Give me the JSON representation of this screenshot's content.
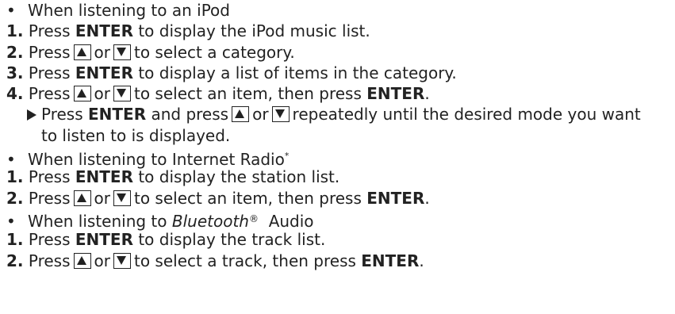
{
  "bullet_char": "•",
  "ipod": {
    "heading": "When listening to an iPod",
    "steps": [
      {
        "num": "1.",
        "pre": "Press",
        "key": "ENTER",
        "post": "to display the iPod music list."
      },
      {
        "num": "2.",
        "pre": "Press",
        "or": "or",
        "post": "to select a category."
      },
      {
        "num": "3.",
        "pre": "Press",
        "key": "ENTER",
        "post": "to display a list of items in the category."
      },
      {
        "num": "4.",
        "pre": "Press",
        "or": "or",
        "post": "to select an item, then press",
        "key": "ENTER",
        "end": "."
      }
    ],
    "note": {
      "pre": "Press",
      "key": "ENTER",
      "mid": "and press",
      "or": "or",
      "post": "repeatedly until the desired mode you want",
      "cont": "to listen to is displayed."
    }
  },
  "radio": {
    "heading": "When listening to Internet Radio",
    "asterisk": "*",
    "steps": [
      {
        "num": "1.",
        "pre": "Press",
        "key": "ENTER",
        "post": "to display the station list."
      },
      {
        "num": "2.",
        "pre": "Press",
        "or": "or",
        "post": "to select an item, then press",
        "key": "ENTER",
        "end": "."
      }
    ]
  },
  "bluetooth": {
    "heading_pre": "When listening to",
    "heading_brand": "Bluetooth",
    "reg": "®",
    "heading_post": "Audio",
    "steps": [
      {
        "num": "1.",
        "pre": "Press",
        "key": "ENTER",
        "post": "to display the track list."
      },
      {
        "num": "2.",
        "pre": "Press",
        "or": "or",
        "post": "to select a track, then press",
        "key": "ENTER",
        "end": "."
      }
    ]
  },
  "icons": {
    "up": "up-arrow-button-icon",
    "down": "down-arrow-button-icon",
    "pointer": "right-triangle-pointer-icon"
  }
}
